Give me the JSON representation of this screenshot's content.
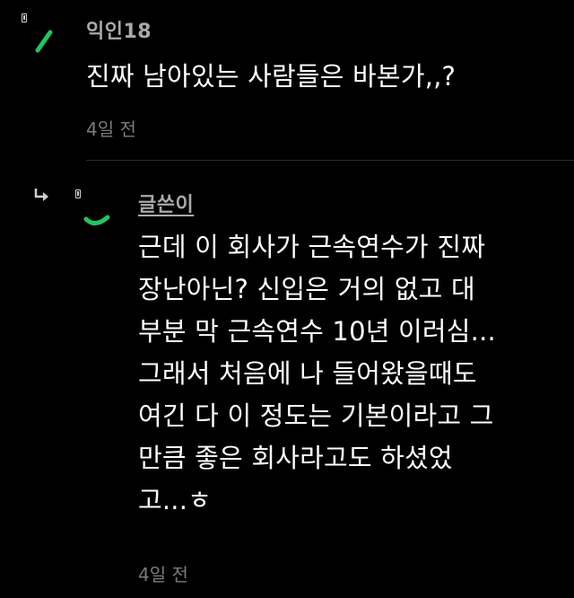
{
  "comments": [
    {
      "author": "익인18",
      "text": "진짜 남아있는 사람들은 바본가,,?",
      "time": "4일 전"
    }
  ],
  "reply": {
    "author": "글쓴이",
    "text": "근데 이 회사가 근속연수가 진짜\n장난아닌? 신입은 거의 없고 대\n부분 막 근속연수 10년 이러심...\n그래서 처음에 나 들어왔을때도\n여긴 다 이 정도는 기본이라고 그\n만큼 좋은 회사라고도 하셨었\n고...ㅎ",
    "time": "4일 전"
  },
  "icons": {
    "mark": "bookmark-icon",
    "avatar": "avatar-icon",
    "reply": "reply-arrow-icon"
  },
  "colors": {
    "accent": "#22c55e",
    "author": "#a9a9a9",
    "time": "#7a7a7a",
    "background": "#000000"
  }
}
